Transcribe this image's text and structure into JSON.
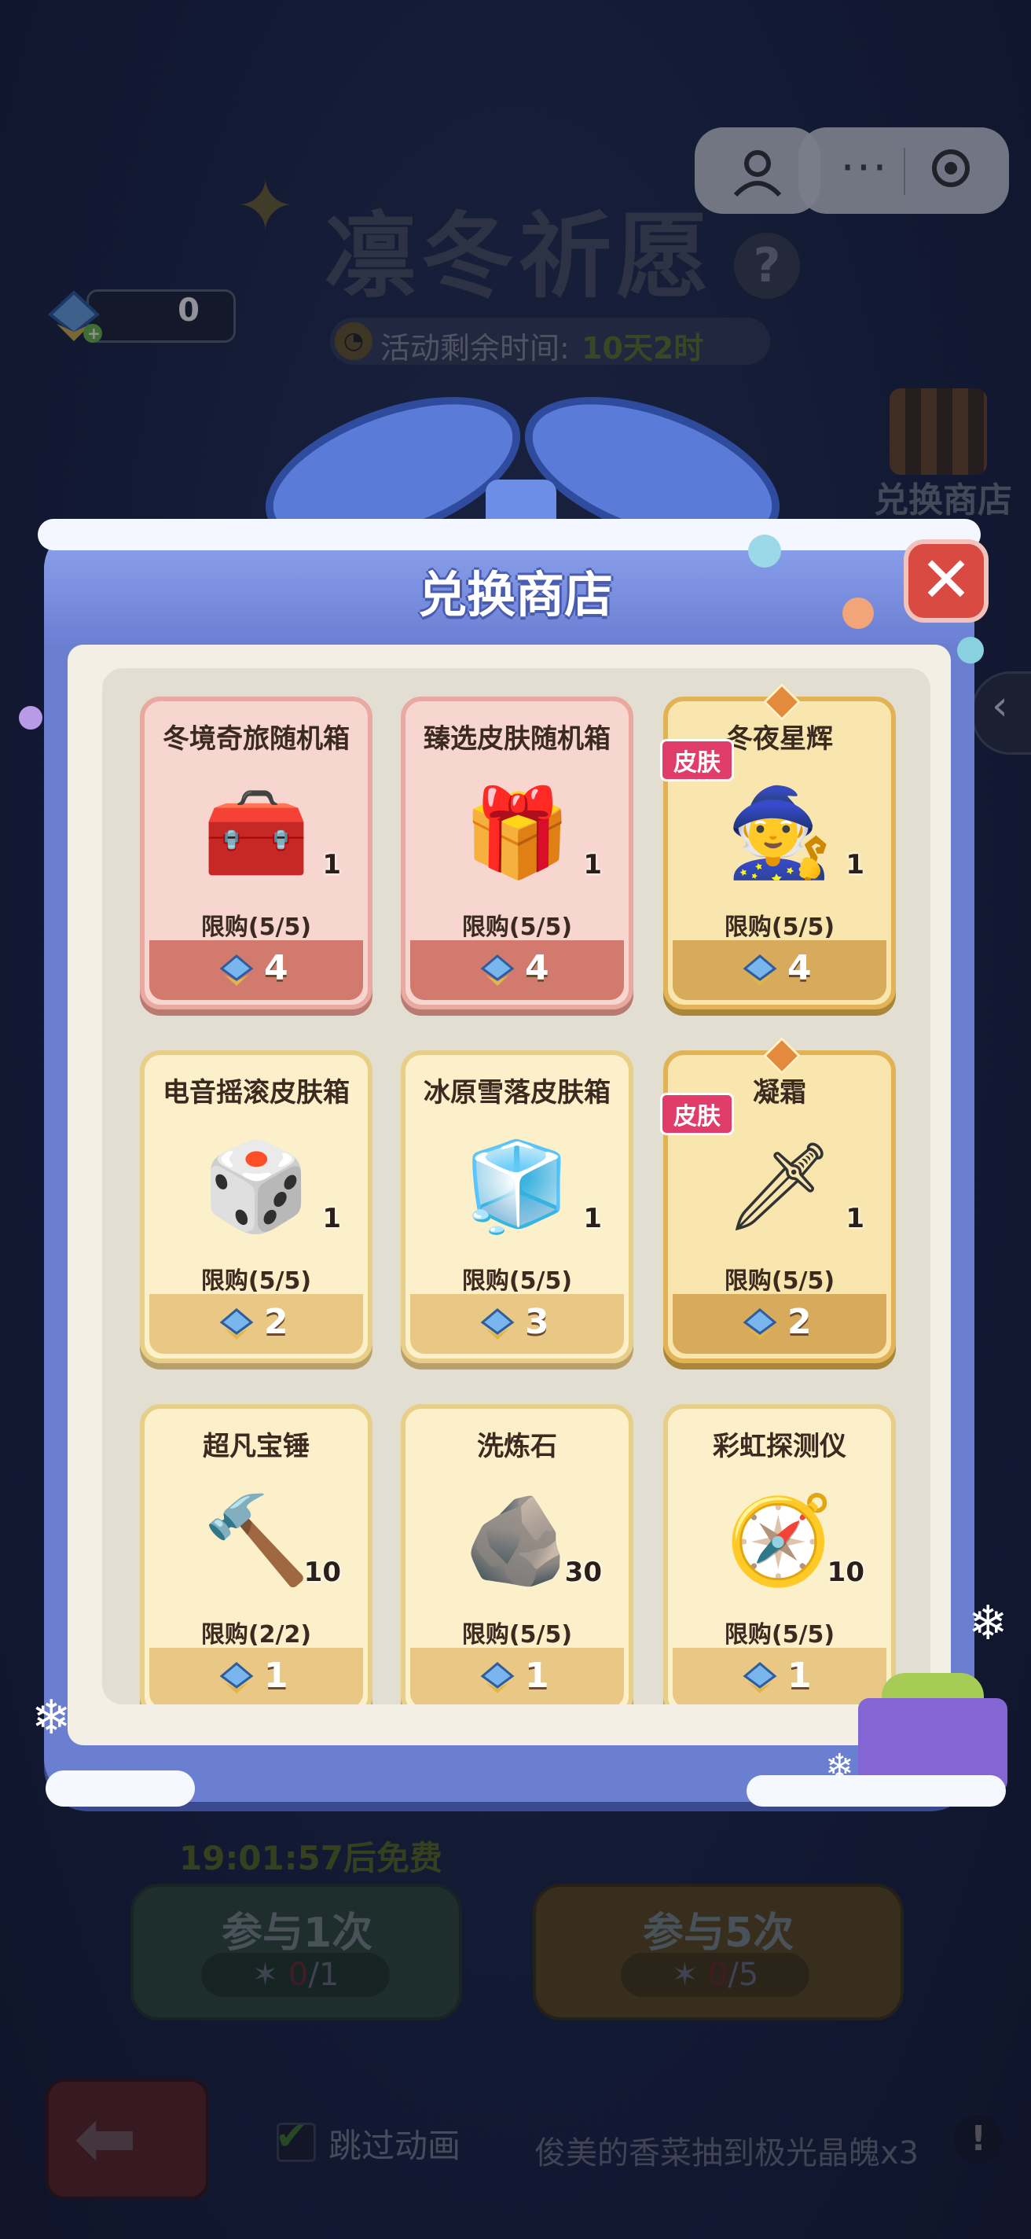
{
  "event": {
    "title": "凛冬祈愿",
    "help_glyph": "?",
    "timer_label": "活动剩余时间:",
    "timer_value": "10天2时"
  },
  "currency": {
    "value": "0",
    "icon": "crystal-gem-icon"
  },
  "mini_program_bar": {
    "menu_glyph": "···",
    "user_icon": "user-icon",
    "close_icon": "target-circle-icon"
  },
  "side_shop": {
    "label": "兑换商店"
  },
  "side_tab": {
    "glyph": "‹"
  },
  "modal": {
    "title": "兑换商店",
    "close_glyph": "✕",
    "colors": {
      "accent": "#6b7fd0",
      "close": "#d94a43",
      "skin_tag": "#e03d6b"
    },
    "items": [
      {
        "name": "冬境奇旅随机箱",
        "qty": "1",
        "limit": "限购(5/5)",
        "price": "4",
        "style": "pink",
        "icon": "treasure-chest-icon",
        "glyph": "🧰",
        "skin_tag": ""
      },
      {
        "name": "臻选皮肤随机箱",
        "qty": "1",
        "limit": "限购(5/5)",
        "price": "4",
        "style": "pink",
        "icon": "mystery-chest-icon",
        "glyph": "🎁",
        "skin_tag": ""
      },
      {
        "name": "冬夜星辉",
        "qty": "1",
        "limit": "限购(5/5)",
        "price": "4",
        "style": "gold",
        "icon": "hero-skin-icon",
        "glyph": "🧙",
        "skin_tag": "皮肤"
      },
      {
        "name": "电音摇滚皮肤箱",
        "qty": "1",
        "limit": "限购(5/5)",
        "price": "2",
        "style": "cream",
        "icon": "skin-box-purple-icon",
        "glyph": "🎲",
        "skin_tag": ""
      },
      {
        "name": "冰原雪落皮肤箱",
        "qty": "1",
        "limit": "限购(5/5)",
        "price": "3",
        "style": "cream",
        "icon": "skin-box-ice-icon",
        "glyph": "🧊",
        "skin_tag": ""
      },
      {
        "name": "凝霜",
        "qty": "1",
        "limit": "限购(5/5)",
        "price": "2",
        "style": "gold",
        "icon": "ice-sword-icon",
        "glyph": "🗡",
        "skin_tag": "皮肤"
      },
      {
        "name": "超凡宝锤",
        "qty": "10",
        "limit": "限购(2/2)",
        "price": "1",
        "style": "cream",
        "icon": "hammer-icon",
        "glyph": "🔨",
        "skin_tag": ""
      },
      {
        "name": "洗炼石",
        "qty": "30",
        "limit": "限购(5/5)",
        "price": "1",
        "style": "cream",
        "icon": "refining-stone-icon",
        "glyph": "🪨",
        "skin_tag": ""
      },
      {
        "name": "彩虹探测仪",
        "qty": "10",
        "limit": "限购(5/5)",
        "price": "1",
        "style": "cream",
        "icon": "rainbow-detector-icon",
        "glyph": "🧭",
        "skin_tag": ""
      }
    ]
  },
  "draw": {
    "free_timer": "19:01:57后免费",
    "one": {
      "label": "参与1次",
      "cost_used": "0",
      "cost_total": "/1"
    },
    "five": {
      "label": "参与5次",
      "cost_used": "0",
      "cost_total": "/5"
    }
  },
  "footer": {
    "skip_label": "跳过动画",
    "ticker": "俊美的香菜抽到极光晶魄x3",
    "alert_glyph": "!"
  }
}
